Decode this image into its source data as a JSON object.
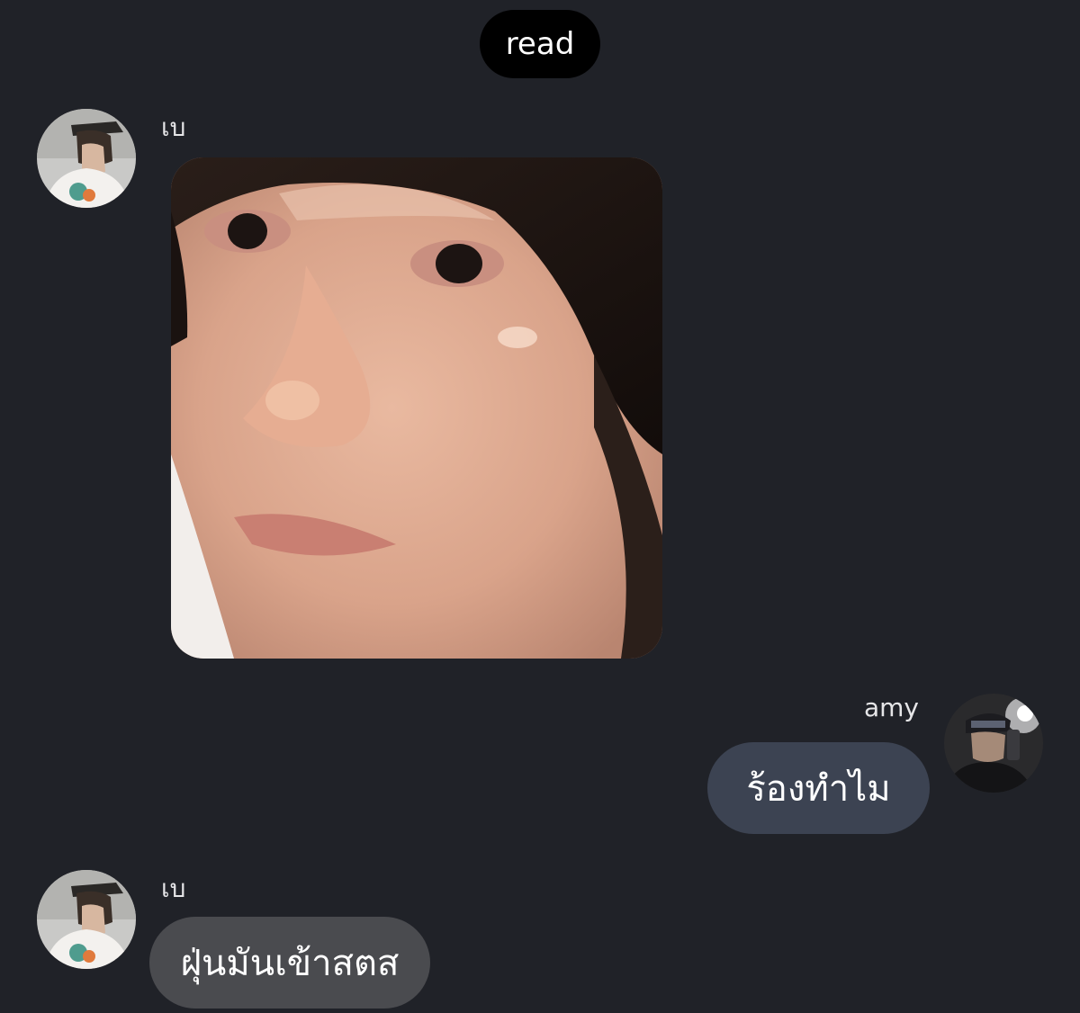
{
  "status": {
    "read_label": "read"
  },
  "colors": {
    "background": "#202228",
    "read_pill": "#000000",
    "outgoing_bubble": "#3c4352",
    "incoming_bubble": "#4a4b4f"
  },
  "messages": [
    {
      "sender": "เบ",
      "direction": "incoming",
      "type": "image",
      "image": "photo-of-face"
    },
    {
      "sender": "amy",
      "direction": "outgoing",
      "type": "text",
      "text": "ร้องทำไม"
    },
    {
      "sender": "เบ",
      "direction": "incoming",
      "type": "text",
      "text": "ฝุ่นมันเข้าสตส"
    }
  ]
}
